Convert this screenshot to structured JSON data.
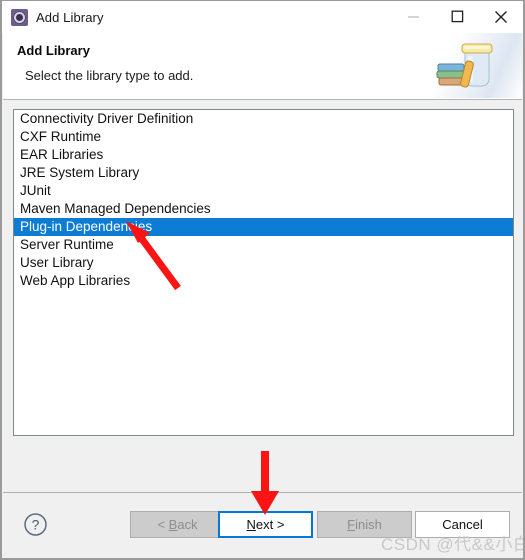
{
  "window": {
    "title": "Add Library",
    "icon": "eclipse-gear-icon",
    "controls": {
      "minimize": "minimize-icon",
      "maximize": "maximize-icon",
      "close": "close-icon"
    }
  },
  "header": {
    "title": "Add Library",
    "description": "Select the library type to add.",
    "banner_icon": "jar-with-books-icon"
  },
  "library_list": {
    "items": [
      {
        "label": "Connectivity Driver Definition",
        "selected": false
      },
      {
        "label": "CXF Runtime",
        "selected": false
      },
      {
        "label": "EAR Libraries",
        "selected": false
      },
      {
        "label": "JRE System Library",
        "selected": false
      },
      {
        "label": "JUnit",
        "selected": false
      },
      {
        "label": "Maven Managed Dependencies",
        "selected": false
      },
      {
        "label": "Plug-in Dependencies",
        "selected": true
      },
      {
        "label": "Server Runtime",
        "selected": false
      },
      {
        "label": "User Library",
        "selected": false
      },
      {
        "label": "Web App Libraries",
        "selected": false
      }
    ],
    "selection_color": "#0c7cd5",
    "selection_text_color": "#ffffff"
  },
  "buttons": {
    "help": "?",
    "back": "< Back",
    "back_mnemonic": "B",
    "next": "Next >",
    "next_mnemonic": "N",
    "finish": "Finish",
    "finish_mnemonic": "F",
    "cancel": "Cancel"
  },
  "annotations": {
    "arrow_color": "#fb1414",
    "arrow_to_selected_item": "red-arrow-pointing-to-plug-in-dependencies",
    "arrow_to_next_button": "red-arrow-pointing-to-next-button"
  },
  "watermark": {
    "text": "CSDN @代&&小白"
  }
}
